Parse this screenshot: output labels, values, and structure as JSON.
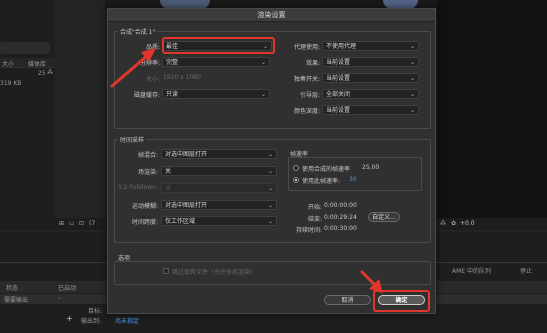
{
  "background": {
    "left_header_col1": "大小",
    "left_header_col2": "媒体库",
    "left_row_value": "25",
    "left_row_size": "319 KB",
    "queue_col_status": "状态",
    "queue_col_started": "已启动",
    "queue_row_status": "需要输出",
    "queue_row_dash": "-",
    "render_settings_label": "目标:",
    "output_to_label": "输出到:",
    "output_to_value": "尚未指定",
    "ame_queue_button": "AME 中的队列",
    "stop_button": "停止",
    "toolbar_value": "+0.0"
  },
  "dialog": {
    "title": "渲染设置",
    "composition_group": "合成\"合成 1\"",
    "quality_label": "品质:",
    "quality_value": "最佳",
    "resolution_label": "分辨率:",
    "resolution_value": "完整",
    "size_label": "大小:",
    "size_value": "1920 x 1080",
    "disk_cache_label": "磁盘缓存:",
    "disk_cache_value": "只读",
    "proxy_use_label": "代理使用:",
    "proxy_use_value": "不使用代理",
    "effects_label": "效果:",
    "effects_value": "当前设置",
    "solo_switches_label": "独奏开关:",
    "solo_switches_value": "当前设置",
    "guide_layers_label": "引导层:",
    "guide_layers_value": "全部关闭",
    "color_depth_label": "颜色深度:",
    "color_depth_value": "当前设置",
    "time_sampling_group": "时间采样",
    "frame_blending_label": "帧混合:",
    "frame_blending_value": "对选中图层打开",
    "field_render_label": "场渲染:",
    "field_render_value": "关",
    "pulldown_label": "3:2 Pulldown:",
    "pulldown_value": "关",
    "motion_blur_label": "运动模糊:",
    "motion_blur_value": "对选中图层打开",
    "time_span_label": "时间跨度:",
    "time_span_value": "仅工作区域",
    "frame_rate_group": "帧速率",
    "use_comp_rate_label": "使用合成的帧速率",
    "use_comp_rate_value": "25.00",
    "use_this_rate_label": "使用此帧速率:",
    "use_this_rate_value": "30",
    "start_label": "开始:",
    "start_value": "0:00:00:00",
    "end_label": "结束:",
    "end_value": "0:00:29:24",
    "duration_label": "持续时间:",
    "duration_value": "0:00:30:00",
    "custom_button": "自定义...",
    "options_group": "选项",
    "skip_existing_label": "跳过现有文件（允许多机渲染）",
    "cancel_button": "取消",
    "ok_button": "确定"
  },
  "colors": {
    "highlight_red": "#e0362c",
    "accent_blue": "#4f9cf0",
    "dialog_bg": "#303030"
  }
}
